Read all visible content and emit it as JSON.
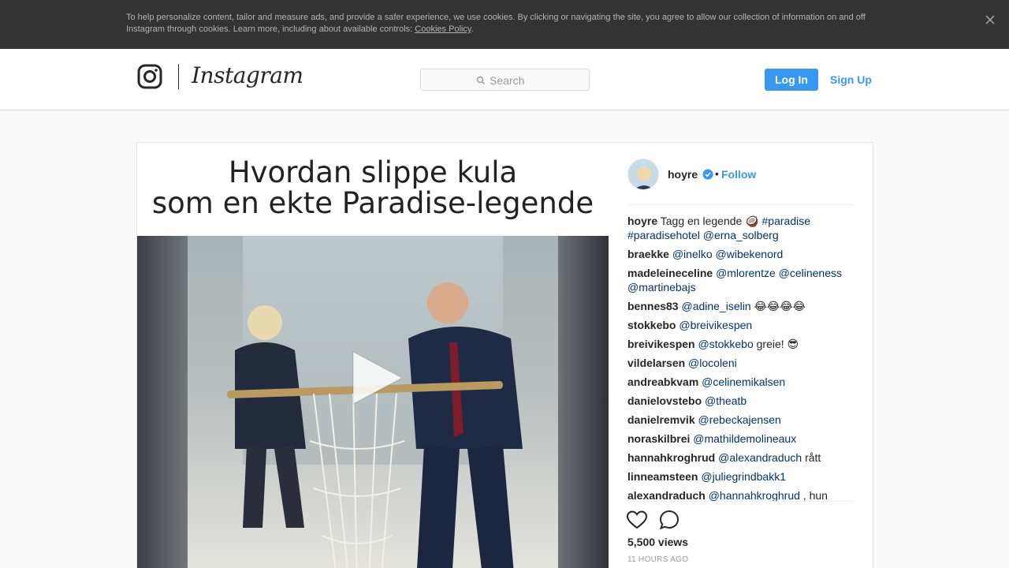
{
  "cookie_banner": {
    "text": "To help personalize content, tailor and measure ads, and provide a safer experience, we use cookies. By clicking or navigating the site, you agree to allow our collection of information on and off Instagram through cookies. Learn more, including about available controls: ",
    "link_label": "Cookies Policy",
    "suffix": ".",
    "close_icon": "close-icon"
  },
  "header": {
    "wordmark": "Instagram",
    "search": {
      "placeholder": "Search",
      "icon": "search-icon"
    },
    "login_label": "Log In",
    "signup_label": "Sign Up"
  },
  "post": {
    "video_title": [
      "Hvordan slippe kula",
      "som en ekte Paradise-legende"
    ],
    "owner": {
      "username": "hoyre",
      "verified": true,
      "separator": "•",
      "follow_label": "Follow"
    },
    "comments": [
      {
        "user": "hoyre",
        "parts": [
          {
            "t": "text",
            "v": " Tagg en legende 🥥 "
          },
          {
            "t": "m",
            "v": "#paradise"
          },
          {
            "t": "text",
            "v": " "
          },
          {
            "t": "m",
            "v": "#paradisehotel"
          },
          {
            "t": "text",
            "v": " "
          },
          {
            "t": "m",
            "v": "@erna_solberg"
          }
        ]
      },
      {
        "user": "braekke",
        "parts": [
          {
            "t": "text",
            "v": " "
          },
          {
            "t": "m",
            "v": "@inelko"
          },
          {
            "t": "text",
            "v": " "
          },
          {
            "t": "m",
            "v": "@wibekenord"
          }
        ]
      },
      {
        "user": "madeleineceline",
        "parts": [
          {
            "t": "text",
            "v": " "
          },
          {
            "t": "m",
            "v": "@mlorentze"
          },
          {
            "t": "text",
            "v": " "
          },
          {
            "t": "m",
            "v": "@celineness"
          },
          {
            "t": "text",
            "v": " "
          },
          {
            "t": "m",
            "v": "@martinebajs"
          }
        ]
      },
      {
        "user": "bennes83",
        "parts": [
          {
            "t": "text",
            "v": " "
          },
          {
            "t": "m",
            "v": "@adine_iselin"
          },
          {
            "t": "text",
            "v": " 😂😂😂😂"
          }
        ]
      },
      {
        "user": "stokkebo",
        "parts": [
          {
            "t": "text",
            "v": " "
          },
          {
            "t": "m",
            "v": "@breivikespen"
          }
        ]
      },
      {
        "user": "breivikespen",
        "parts": [
          {
            "t": "text",
            "v": " "
          },
          {
            "t": "m",
            "v": "@stokkebo"
          },
          {
            "t": "text",
            "v": " greie! 😎"
          }
        ]
      },
      {
        "user": "vildelarsen",
        "parts": [
          {
            "t": "text",
            "v": " "
          },
          {
            "t": "m",
            "v": "@locoleni"
          }
        ]
      },
      {
        "user": "andreabkvam",
        "parts": [
          {
            "t": "text",
            "v": " "
          },
          {
            "t": "m",
            "v": "@celinemikalsen"
          }
        ]
      },
      {
        "user": "danielovstebo",
        "parts": [
          {
            "t": "text",
            "v": " "
          },
          {
            "t": "m",
            "v": "@theatb"
          }
        ]
      },
      {
        "user": "danielremvik",
        "parts": [
          {
            "t": "text",
            "v": " "
          },
          {
            "t": "m",
            "v": "@rebeckajensen"
          }
        ]
      },
      {
        "user": "noraskilbrei",
        "parts": [
          {
            "t": "text",
            "v": " "
          },
          {
            "t": "m",
            "v": "@mathildemolineaux"
          }
        ]
      },
      {
        "user": "hannahkroghrud",
        "parts": [
          {
            "t": "text",
            "v": " "
          },
          {
            "t": "m",
            "v": "@alexandraduch"
          },
          {
            "t": "text",
            "v": " rått"
          }
        ]
      },
      {
        "user": "linneamsteen",
        "parts": [
          {
            "t": "text",
            "v": " "
          },
          {
            "t": "m",
            "v": "@juliegrindbakk1"
          }
        ]
      },
      {
        "user": "alexandraduch",
        "parts": [
          {
            "t": "text",
            "v": " "
          },
          {
            "t": "m",
            "v": "@hannahkroghrud"
          },
          {
            "t": "text",
            "v": " , hun"
          }
        ]
      }
    ],
    "views": "5,500 views",
    "time": "11 HOURS AGO",
    "icons": {
      "like": "heart-icon",
      "comment": "comment-icon",
      "play": "play-icon",
      "verified": "verified-badge-icon"
    },
    "colors": {
      "accent": "#3897f0",
      "mention": "#003569"
    }
  }
}
